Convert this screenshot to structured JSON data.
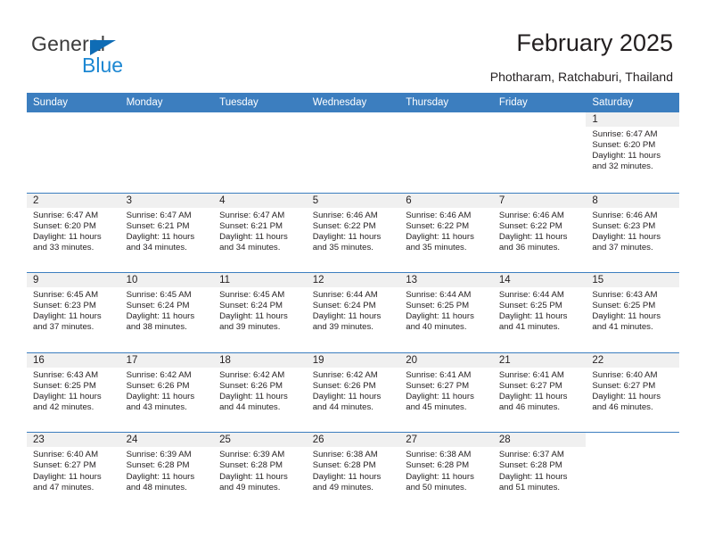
{
  "brand": {
    "name_top": "General",
    "name_bottom": "Blue",
    "triangle_icon": "triangle-icon",
    "color_dark": "#3b3b3b",
    "color_blue": "#1c87d2",
    "color_triangle": "#0f6cb5"
  },
  "header": {
    "title": "February 2025",
    "subtitle": "Photharam, Ratchaburi, Thailand"
  },
  "theme": {
    "header_row_bg": "#3c7ebf",
    "header_row_text": "#ffffff",
    "daynum_band_bg": "#f0f0f0",
    "row_divider": "#3c7ebf",
    "text": "#231f20"
  },
  "calendar": {
    "weekday_headers": [
      "Sunday",
      "Monday",
      "Tuesday",
      "Wednesday",
      "Thursday",
      "Friday",
      "Saturday"
    ],
    "weeks": [
      [
        {
          "day": "",
          "lines": []
        },
        {
          "day": "",
          "lines": []
        },
        {
          "day": "",
          "lines": []
        },
        {
          "day": "",
          "lines": []
        },
        {
          "day": "",
          "lines": []
        },
        {
          "day": "",
          "lines": []
        },
        {
          "day": "1",
          "lines": [
            "Sunrise: 6:47 AM",
            "Sunset: 6:20 PM",
            "Daylight: 11 hours",
            "and 32 minutes."
          ]
        }
      ],
      [
        {
          "day": "2",
          "lines": [
            "Sunrise: 6:47 AM",
            "Sunset: 6:20 PM",
            "Daylight: 11 hours",
            "and 33 minutes."
          ]
        },
        {
          "day": "3",
          "lines": [
            "Sunrise: 6:47 AM",
            "Sunset: 6:21 PM",
            "Daylight: 11 hours",
            "and 34 minutes."
          ]
        },
        {
          "day": "4",
          "lines": [
            "Sunrise: 6:47 AM",
            "Sunset: 6:21 PM",
            "Daylight: 11 hours",
            "and 34 minutes."
          ]
        },
        {
          "day": "5",
          "lines": [
            "Sunrise: 6:46 AM",
            "Sunset: 6:22 PM",
            "Daylight: 11 hours",
            "and 35 minutes."
          ]
        },
        {
          "day": "6",
          "lines": [
            "Sunrise: 6:46 AM",
            "Sunset: 6:22 PM",
            "Daylight: 11 hours",
            "and 35 minutes."
          ]
        },
        {
          "day": "7",
          "lines": [
            "Sunrise: 6:46 AM",
            "Sunset: 6:22 PM",
            "Daylight: 11 hours",
            "and 36 minutes."
          ]
        },
        {
          "day": "8",
          "lines": [
            "Sunrise: 6:46 AM",
            "Sunset: 6:23 PM",
            "Daylight: 11 hours",
            "and 37 minutes."
          ]
        }
      ],
      [
        {
          "day": "9",
          "lines": [
            "Sunrise: 6:45 AM",
            "Sunset: 6:23 PM",
            "Daylight: 11 hours",
            "and 37 minutes."
          ]
        },
        {
          "day": "10",
          "lines": [
            "Sunrise: 6:45 AM",
            "Sunset: 6:24 PM",
            "Daylight: 11 hours",
            "and 38 minutes."
          ]
        },
        {
          "day": "11",
          "lines": [
            "Sunrise: 6:45 AM",
            "Sunset: 6:24 PM",
            "Daylight: 11 hours",
            "and 39 minutes."
          ]
        },
        {
          "day": "12",
          "lines": [
            "Sunrise: 6:44 AM",
            "Sunset: 6:24 PM",
            "Daylight: 11 hours",
            "and 39 minutes."
          ]
        },
        {
          "day": "13",
          "lines": [
            "Sunrise: 6:44 AM",
            "Sunset: 6:25 PM",
            "Daylight: 11 hours",
            "and 40 minutes."
          ]
        },
        {
          "day": "14",
          "lines": [
            "Sunrise: 6:44 AM",
            "Sunset: 6:25 PM",
            "Daylight: 11 hours",
            "and 41 minutes."
          ]
        },
        {
          "day": "15",
          "lines": [
            "Sunrise: 6:43 AM",
            "Sunset: 6:25 PM",
            "Daylight: 11 hours",
            "and 41 minutes."
          ]
        }
      ],
      [
        {
          "day": "16",
          "lines": [
            "Sunrise: 6:43 AM",
            "Sunset: 6:25 PM",
            "Daylight: 11 hours",
            "and 42 minutes."
          ]
        },
        {
          "day": "17",
          "lines": [
            "Sunrise: 6:42 AM",
            "Sunset: 6:26 PM",
            "Daylight: 11 hours",
            "and 43 minutes."
          ]
        },
        {
          "day": "18",
          "lines": [
            "Sunrise: 6:42 AM",
            "Sunset: 6:26 PM",
            "Daylight: 11 hours",
            "and 44 minutes."
          ]
        },
        {
          "day": "19",
          "lines": [
            "Sunrise: 6:42 AM",
            "Sunset: 6:26 PM",
            "Daylight: 11 hours",
            "and 44 minutes."
          ]
        },
        {
          "day": "20",
          "lines": [
            "Sunrise: 6:41 AM",
            "Sunset: 6:27 PM",
            "Daylight: 11 hours",
            "and 45 minutes."
          ]
        },
        {
          "day": "21",
          "lines": [
            "Sunrise: 6:41 AM",
            "Sunset: 6:27 PM",
            "Daylight: 11 hours",
            "and 46 minutes."
          ]
        },
        {
          "day": "22",
          "lines": [
            "Sunrise: 6:40 AM",
            "Sunset: 6:27 PM",
            "Daylight: 11 hours",
            "and 46 minutes."
          ]
        }
      ],
      [
        {
          "day": "23",
          "lines": [
            "Sunrise: 6:40 AM",
            "Sunset: 6:27 PM",
            "Daylight: 11 hours",
            "and 47 minutes."
          ]
        },
        {
          "day": "24",
          "lines": [
            "Sunrise: 6:39 AM",
            "Sunset: 6:28 PM",
            "Daylight: 11 hours",
            "and 48 minutes."
          ]
        },
        {
          "day": "25",
          "lines": [
            "Sunrise: 6:39 AM",
            "Sunset: 6:28 PM",
            "Daylight: 11 hours",
            "and 49 minutes."
          ]
        },
        {
          "day": "26",
          "lines": [
            "Sunrise: 6:38 AM",
            "Sunset: 6:28 PM",
            "Daylight: 11 hours",
            "and 49 minutes."
          ]
        },
        {
          "day": "27",
          "lines": [
            "Sunrise: 6:38 AM",
            "Sunset: 6:28 PM",
            "Daylight: 11 hours",
            "and 50 minutes."
          ]
        },
        {
          "day": "28",
          "lines": [
            "Sunrise: 6:37 AM",
            "Sunset: 6:28 PM",
            "Daylight: 11 hours",
            "and 51 minutes."
          ]
        },
        {
          "day": "",
          "lines": []
        }
      ]
    ]
  }
}
